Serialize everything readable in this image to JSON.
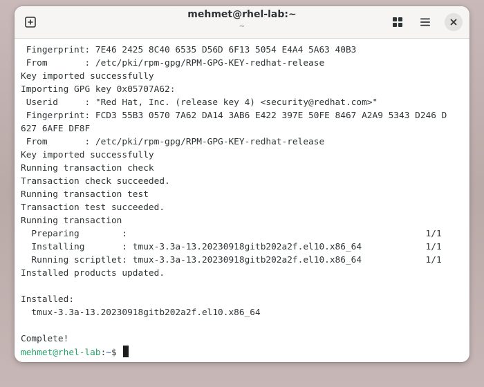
{
  "window": {
    "title": "mehmet@rhel-lab:~",
    "subtitle": "~",
    "icons": {
      "new_tab": "plus-box-icon",
      "tabs": "grid-icon",
      "menu": "hamburger-menu-icon",
      "close": "close-icon"
    }
  },
  "terminal": {
    "lines": [
      " Fingerprint: 7E46 2425 8C40 6535 D56D 6F13 5054 E4A4 5A63 40B3",
      " From       : /etc/pki/rpm-gpg/RPM-GPG-KEY-redhat-release",
      "Key imported successfully",
      "Importing GPG key 0x05707A62:",
      " Userid     : \"Red Hat, Inc. (release key 4) <security@redhat.com>\"",
      " Fingerprint: FCD3 55B3 0570 7A62 DA14 3AB6 E422 397E 50FE 8467 A2A9 5343 D246 D",
      "627 6AFE DF8F",
      " From       : /etc/pki/rpm-gpg/RPM-GPG-KEY-redhat-release",
      "Key imported successfully",
      "Running transaction check",
      "Transaction check succeeded.",
      "Running transaction test",
      "Transaction test succeeded.",
      "Running transaction",
      "  Preparing        :                                                        1/1",
      "  Installing       : tmux-3.3a-13.20230918gitb202a2f.el10.x86_64            1/1",
      "  Running scriptlet: tmux-3.3a-13.20230918gitb202a2f.el10.x86_64            1/1",
      "Installed products updated.",
      "",
      "Installed:",
      "  tmux-3.3a-13.20230918gitb202a2f.el10.x86_64",
      "",
      "Complete!"
    ],
    "prompt": {
      "user_host": "mehmet@rhel-lab",
      "separator": ":",
      "path": "~",
      "symbol": "$ "
    }
  }
}
